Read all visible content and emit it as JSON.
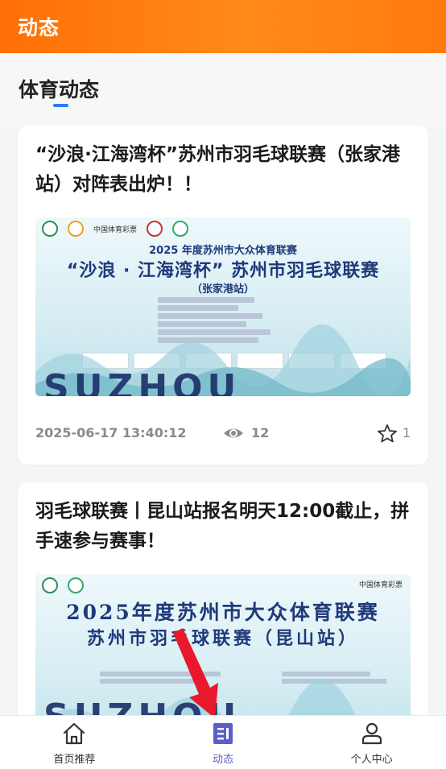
{
  "header": {
    "title": "动态"
  },
  "section": {
    "title": "体育动态"
  },
  "posts": [
    {
      "title": "“沙浪·江海湾杯”苏州市羽毛球联赛（张家港站）对阵表出炉！！",
      "poster": {
        "logo_text": "中国体育彩票",
        "line1": "2025 年度苏州市大众体育联赛",
        "line2": "“沙浪 · 江海湾杯” 苏州市羽毛球联赛",
        "line3": "（张家港站）",
        "big_text": "SUZHOU"
      },
      "date": "2025-06-17 13:40:12",
      "views": "12",
      "favorites": "1"
    },
    {
      "title": "羽毛球联赛丨昆山站报名明天12:00截止，拼手速参与赛事！",
      "poster": {
        "logo_text": "中国体育彩票",
        "line1": "2025年度苏州市大众体育联赛",
        "line2": "苏州市羽毛球联赛（昆山站）",
        "big_text": "SUZHOU"
      }
    }
  ],
  "tabbar": {
    "items": [
      {
        "label": "首页推荐",
        "icon": "home-icon"
      },
      {
        "label": "动态",
        "icon": "news-icon"
      },
      {
        "label": "个人中心",
        "icon": "user-icon"
      }
    ],
    "active_index": 1,
    "active_color": "#5b5fc7"
  },
  "colors": {
    "header": "#ff7a0e",
    "accent": "#2f7bf6",
    "arrow": "#e8192c"
  }
}
